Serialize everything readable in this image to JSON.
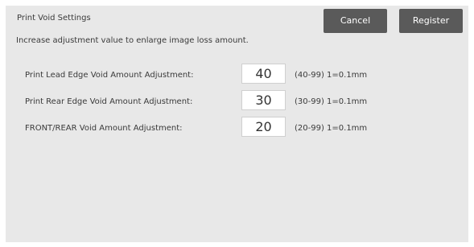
{
  "title": "Print Void Settings",
  "buttons": {
    "cancel": "Cancel",
    "register": "Register"
  },
  "hint": "Increase adjustment value to enlarge image loss amount.",
  "rows": [
    {
      "label": "Print Lead Edge Void Amount Adjustment:",
      "value": "40",
      "range": "(40-99) 1=0.1mm"
    },
    {
      "label": "Print Rear Edge Void Amount Adjustment:",
      "value": "30",
      "range": "(30-99) 1=0.1mm"
    },
    {
      "label": "FRONT/REAR Void Amount Adjustment:",
      "value": "20",
      "range": "(20-99) 1=0.1mm"
    }
  ],
  "colors": {
    "panel_background": "#e8e8e8",
    "button_background": "#5a5a5a",
    "button_text": "#ffffff",
    "input_background": "#ffffff"
  }
}
